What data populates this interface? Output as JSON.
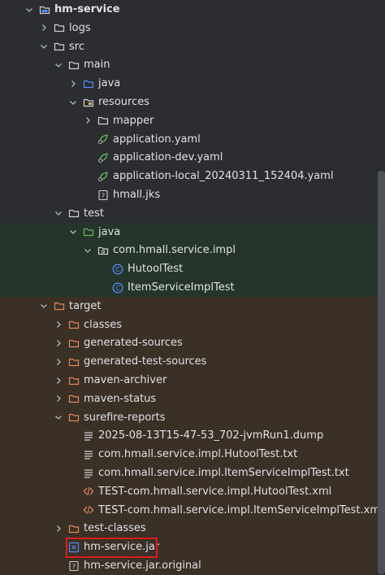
{
  "tree": [
    {
      "label": "hm-service",
      "icon": "module-folder-icon",
      "arrow": "down",
      "depth": 0,
      "zone": "",
      "bold": true
    },
    {
      "label": "logs",
      "icon": "folder-icon",
      "arrow": "right",
      "depth": 1,
      "zone": ""
    },
    {
      "label": "src",
      "icon": "folder-icon",
      "arrow": "down",
      "depth": 1,
      "zone": ""
    },
    {
      "label": "main",
      "icon": "folder-icon",
      "arrow": "down",
      "depth": 2,
      "zone": ""
    },
    {
      "label": "java",
      "icon": "source-folder-icon",
      "arrow": "right",
      "depth": 3,
      "zone": ""
    },
    {
      "label": "resources",
      "icon": "resources-folder-icon",
      "arrow": "down",
      "depth": 3,
      "zone": ""
    },
    {
      "label": "mapper",
      "icon": "folder-icon",
      "arrow": "right",
      "depth": 4,
      "zone": ""
    },
    {
      "label": "application.yaml",
      "icon": "spring-config-icon",
      "arrow": "none",
      "depth": 4,
      "zone": ""
    },
    {
      "label": "application-dev.yaml",
      "icon": "spring-config-icon",
      "arrow": "none",
      "depth": 4,
      "zone": ""
    },
    {
      "label": "application-local_20240311_152404.yaml",
      "icon": "spring-config-icon",
      "arrow": "none",
      "depth": 4,
      "zone": ""
    },
    {
      "label": "hmall.jks",
      "icon": "unknown-file-icon",
      "arrow": "none",
      "depth": 4,
      "zone": ""
    },
    {
      "label": "test",
      "icon": "folder-icon",
      "arrow": "down",
      "depth": 2,
      "zone": ""
    },
    {
      "label": "java",
      "icon": "test-folder-icon",
      "arrow": "down",
      "depth": 3,
      "zone": "test"
    },
    {
      "label": "com.hmall.service.impl",
      "icon": "package-icon",
      "arrow": "down",
      "depth": 4,
      "zone": "test"
    },
    {
      "label": "HutoolTest",
      "icon": "class-icon",
      "arrow": "none",
      "depth": 5,
      "zone": "test"
    },
    {
      "label": "ItemServiceImplTest",
      "icon": "class-icon",
      "arrow": "none",
      "depth": 5,
      "zone": "test"
    },
    {
      "label": "target",
      "icon": "excluded-folder-icon",
      "arrow": "down",
      "depth": 1,
      "zone": "target"
    },
    {
      "label": "classes",
      "icon": "excluded-folder-icon",
      "arrow": "right",
      "depth": 2,
      "zone": "target"
    },
    {
      "label": "generated-sources",
      "icon": "excluded-folder-icon",
      "arrow": "right",
      "depth": 2,
      "zone": "target"
    },
    {
      "label": "generated-test-sources",
      "icon": "excluded-folder-icon",
      "arrow": "right",
      "depth": 2,
      "zone": "target"
    },
    {
      "label": "maven-archiver",
      "icon": "excluded-folder-icon",
      "arrow": "right",
      "depth": 2,
      "zone": "target"
    },
    {
      "label": "maven-status",
      "icon": "excluded-folder-icon",
      "arrow": "right",
      "depth": 2,
      "zone": "target"
    },
    {
      "label": "surefire-reports",
      "icon": "excluded-folder-icon",
      "arrow": "down",
      "depth": 2,
      "zone": "target"
    },
    {
      "label": "2025-08-13T15-47-53_702-jvmRun1.dump",
      "icon": "text-file-icon",
      "arrow": "none",
      "depth": 3,
      "zone": "target"
    },
    {
      "label": "com.hmall.service.impl.HutoolTest.txt",
      "icon": "text-file-icon",
      "arrow": "none",
      "depth": 3,
      "zone": "target"
    },
    {
      "label": "com.hmall.service.impl.ItemServiceImplTest.txt",
      "icon": "text-file-icon",
      "arrow": "none",
      "depth": 3,
      "zone": "target"
    },
    {
      "label": "TEST-com.hmall.service.impl.HutoolTest.xml",
      "icon": "xml-file-icon",
      "arrow": "none",
      "depth": 3,
      "zone": "target"
    },
    {
      "label": "TEST-com.hmall.service.impl.ItemServiceImplTest.xml",
      "icon": "xml-file-icon",
      "arrow": "none",
      "depth": 3,
      "zone": "target"
    },
    {
      "label": "test-classes",
      "icon": "excluded-folder-icon",
      "arrow": "right",
      "depth": 2,
      "zone": "target"
    },
    {
      "label": "hm-service.jar",
      "icon": "jar-file-icon",
      "arrow": "none",
      "depth": 2,
      "zone": "target",
      "highlighted": true
    },
    {
      "label": "hm-service.jar.original",
      "icon": "unknown-file-icon",
      "arrow": "none",
      "depth": 2,
      "zone": "target"
    }
  ],
  "colors": {
    "background": "#2b2d30",
    "test_zone": "#263529",
    "target_zone": "#3a3026",
    "highlight": "#e01b1b"
  }
}
